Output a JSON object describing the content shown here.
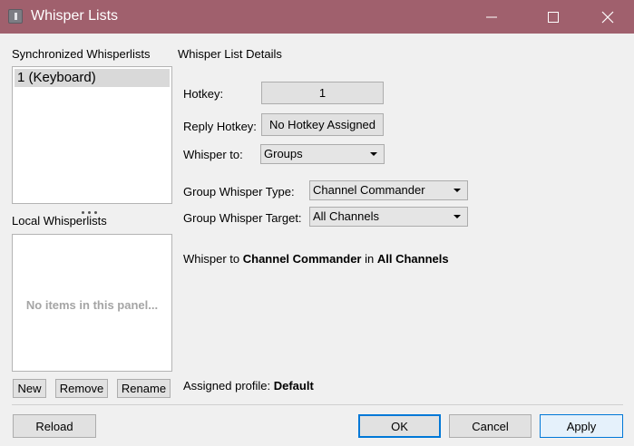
{
  "window": {
    "title": "Whisper Lists",
    "icon": "teamspeak-icon",
    "minimize_icon": "minimize-icon",
    "maximize_icon": "maximize-icon",
    "close_icon": "close-icon",
    "titlebar_color": "#a0606d"
  },
  "left": {
    "synced_heading": "Synchronized Whisperlists",
    "synced_items": [
      "1 (Keyboard)"
    ],
    "local_heading": "Local Whisperlists",
    "local_empty": "No items in this panel...",
    "new_label": "New",
    "remove_label": "Remove",
    "rename_label": "Rename"
  },
  "details": {
    "heading": "Whisper List Details",
    "hotkey_label": "Hotkey:",
    "hotkey_value": "1",
    "reply_hotkey_label": "Reply Hotkey:",
    "reply_hotkey_value": "No Hotkey Assigned",
    "whisper_to_label": "Whisper to:",
    "whisper_to_value": "Groups",
    "group_type_label": "Group Whisper Type:",
    "group_type_value": "Channel Commander",
    "group_target_label": "Group Whisper Target:",
    "group_target_value": "All Channels",
    "summary_prefix": "Whisper to ",
    "summary_type": "Channel Commander",
    "summary_mid": " in ",
    "summary_target": "All Channels",
    "assigned_profile_label": "Assigned profile: ",
    "assigned_profile_value": "Default"
  },
  "footer": {
    "reload_label": "Reload",
    "ok_label": "OK",
    "cancel_label": "Cancel",
    "apply_label": "Apply"
  }
}
